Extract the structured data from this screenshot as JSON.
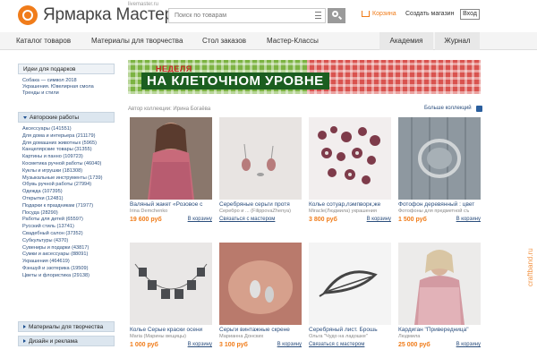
{
  "header": {
    "logo_text": "Ярмарка Мастеров",
    "logo_sub": "livemaster.ru",
    "search_placeholder": "Поиск по товарам",
    "cart_label": "Корзина",
    "create_shop_label": "Создать магазин",
    "login_label": "Вход",
    "accent_color": "#f07c1a"
  },
  "nav": {
    "items": [
      "Каталог товаров",
      "Материалы для творчества",
      "Стол заказов",
      "Мастер-Классы",
      "Академия",
      "Журнал"
    ]
  },
  "sidebar": {
    "ideas_title": "Идеи для подарков",
    "ideas_links": [
      "Собака — символ 2018",
      "Украшения. Ювелирная смола",
      "Тренды и стили"
    ],
    "author_title": "Авторские работы",
    "categories": [
      "Аксессуары (141551)",
      "Для дома и интерьера (211179)",
      "Для домашних животных (5965)",
      "Канцелярские товары (31355)",
      "Картины и панно (109723)",
      "Косметика ручной работы (46040)",
      "Куклы и игрушки (181308)",
      "Музыкальные инструменты (1739)",
      "Обувь ручной работы (27994)",
      "Одежда (107395)",
      "Открытки (12481)",
      "Подарки к праздникам (71977)",
      "Посуда (28290)",
      "Работы для детей (65597)",
      "Русский стиль (13741)",
      "Свадебный салон (37352)",
      "Субкультуры (4370)",
      "Сувениры и подарки (43817)",
      "Сумки и аксессуары (88091)",
      "Украшения (464619)",
      "Фэншуй и эзотерика (19509)",
      "Цветы и флористика (29138)"
    ],
    "materials_title": "Материалы для творчества",
    "design_title": "Дизайн и реклама"
  },
  "banner": {
    "small_text": "НЕДЕЛЯ",
    "big_text": "НА КЛЕТОЧНОМ УРОВНЕ"
  },
  "collection": {
    "author_label": "Автор коллекции: Ирина Богаёва",
    "more_label": "Больше коллекций"
  },
  "products": [
    {
      "title": "Валяный жакет «Розовое с",
      "author": "Irina Demchenko",
      "price": "19 600 руб",
      "action": "В корзину"
    },
    {
      "title": "Серебряные серьги протя",
      "author": "Серебро и ... (FilippovaZhenya)",
      "price": "",
      "action": "Связаться с мастером"
    },
    {
      "title": "Колье сотуар,лэмпворк,же",
      "author": "Miracle(Людмила) украшения",
      "price": "3 800 руб",
      "action": "В корзину"
    },
    {
      "title": "Фотофон деревянный : цвет",
      "author": "Фотофоны для предметной съ",
      "price": "1 500 руб",
      "action": "В корзину"
    },
    {
      "title": "Колье Серые краски осени",
      "author": "Maria (Марины вещицы)",
      "price": "1 000 руб",
      "action": "В корзину"
    },
    {
      "title": "Серьги винтажные скрене",
      "author": "Марианна Донских",
      "price": "3 100 руб",
      "action": "В корзину"
    },
    {
      "title": "Серебряный лист. Брошь",
      "author": "Ольга \"Чудо на ладошке\"",
      "price": "",
      "action": "Связаться с мастером"
    },
    {
      "title": "Кардиган \"Привередница\"",
      "author": "Людмила",
      "price": "25 000 руб",
      "action": "В корзину"
    }
  ],
  "watermark": "craftband.ru"
}
